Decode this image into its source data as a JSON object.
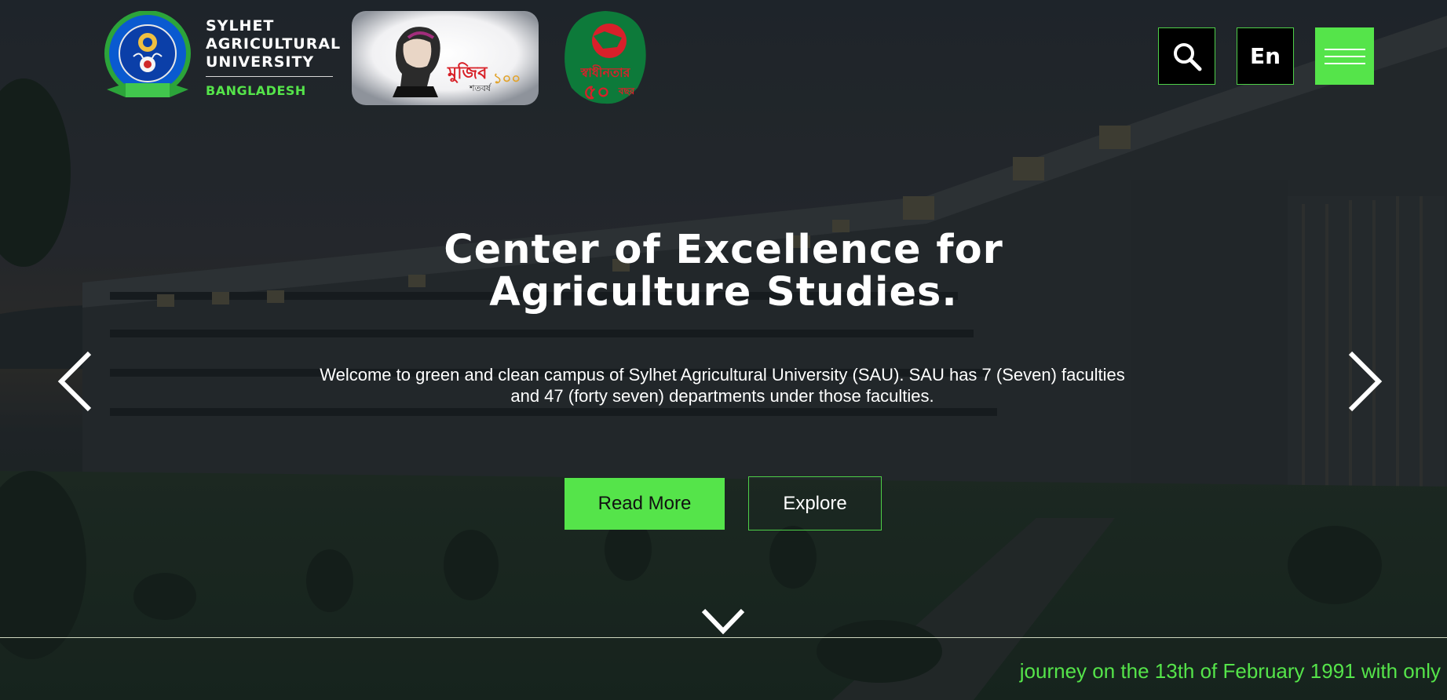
{
  "university": {
    "name_line1": "SYLHET",
    "name_line2": "AGRICULTURAL",
    "name_line3": "UNIVERSITY",
    "country": "BANGLADESH",
    "seal_ring_text": "SYLHET AGRICULTURAL UNIVERSITY",
    "seal_base_text": "SYLHET",
    "seal_ribbon_text": "সিলেট কৃষি বিশ্ববিদ্যালয়"
  },
  "logos": {
    "mujib_main": "মুজিব",
    "mujib_sub": "শতবর্ষ",
    "mujib_year": "১০০",
    "golden_main": "স্বাধীনতার",
    "golden_num": "৫০",
    "golden_sub": "বছর"
  },
  "header": {
    "search_icon": "search-icon",
    "lang_label": "En",
    "menu_icon": "hamburger-icon"
  },
  "hero": {
    "title_line1": "Center of Excellence for",
    "title_line2": "Agriculture Studies.",
    "desc_line1": "Welcome to green and clean campus of Sylhet Agricultural University (SAU). SAU has 7 (Seven) faculties",
    "desc_line2": "and 47 (forty seven) departments under those faculties.",
    "primary_label": "Read More",
    "secondary_label": "Explore",
    "prev_icon": "chevron-left-icon",
    "next_icon": "chevron-right-icon",
    "scroll_icon": "chevron-down-icon"
  },
  "ticker": {
    "text": "journey on the 13th of February 1991 with only"
  },
  "colors": {
    "accent": "#55e44a",
    "overlay": "#1b2126",
    "button_dark": "#000000"
  }
}
